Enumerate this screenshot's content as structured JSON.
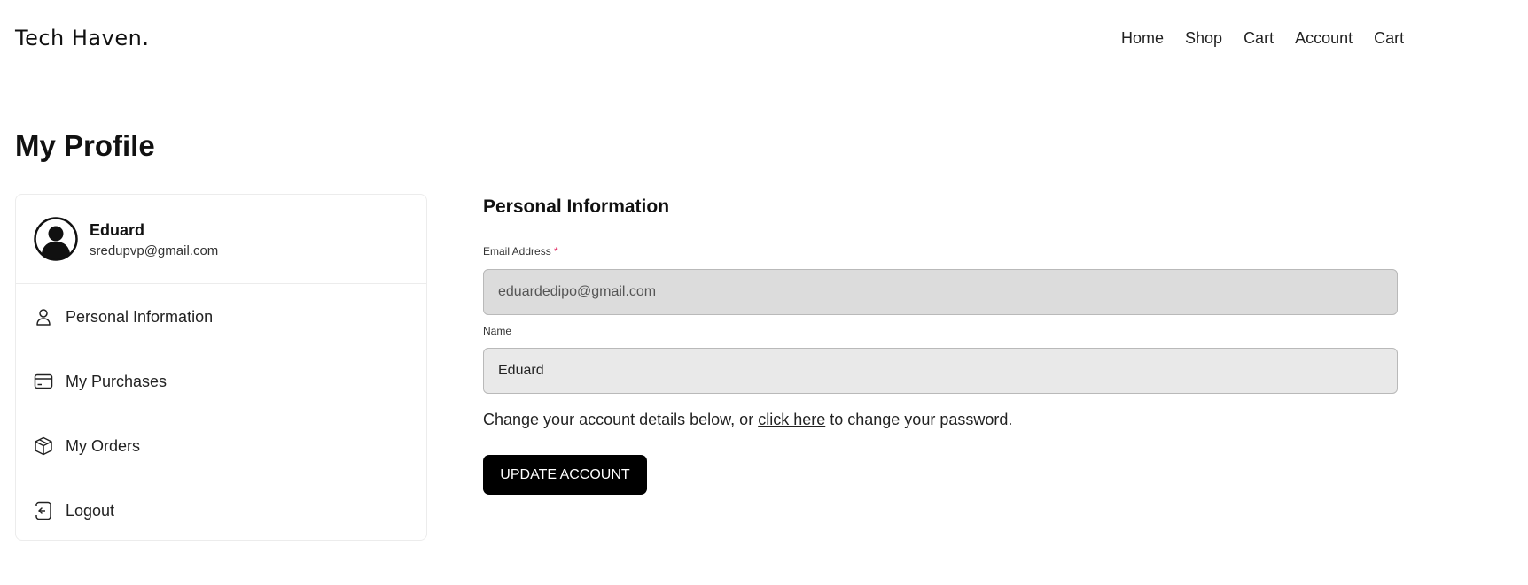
{
  "header": {
    "logo": "Tech Haven.",
    "nav": [
      "Home",
      "Shop",
      "Cart",
      "Account",
      "Cart"
    ]
  },
  "page_title": "My Profile",
  "sidebar": {
    "user_name": "Eduard",
    "user_email": "sredupvp@gmail.com",
    "avatar_icon": "user-circle-icon",
    "items": [
      {
        "label": "Personal Information",
        "icon": "user-icon"
      },
      {
        "label": "My Purchases",
        "icon": "credit-card-icon"
      },
      {
        "label": "My Orders",
        "icon": "package-icon"
      },
      {
        "label": "Logout",
        "icon": "logout-icon"
      }
    ]
  },
  "form": {
    "title": "Personal Information",
    "email_label": "Email Address",
    "required_marker": "*",
    "email_value": "eduardedipo@gmail.com",
    "name_label": "Name",
    "name_value": "Eduard",
    "help_prefix": "Change your account details below, or ",
    "help_link": "click here",
    "help_suffix": " to change your password.",
    "submit_label": "UPDATE ACCOUNT"
  },
  "colors": {
    "button_bg": "#000000",
    "required_marker": "#e0245e",
    "email_input_bg": "#dcdcdc",
    "name_input_bg": "#e9e9e9"
  }
}
